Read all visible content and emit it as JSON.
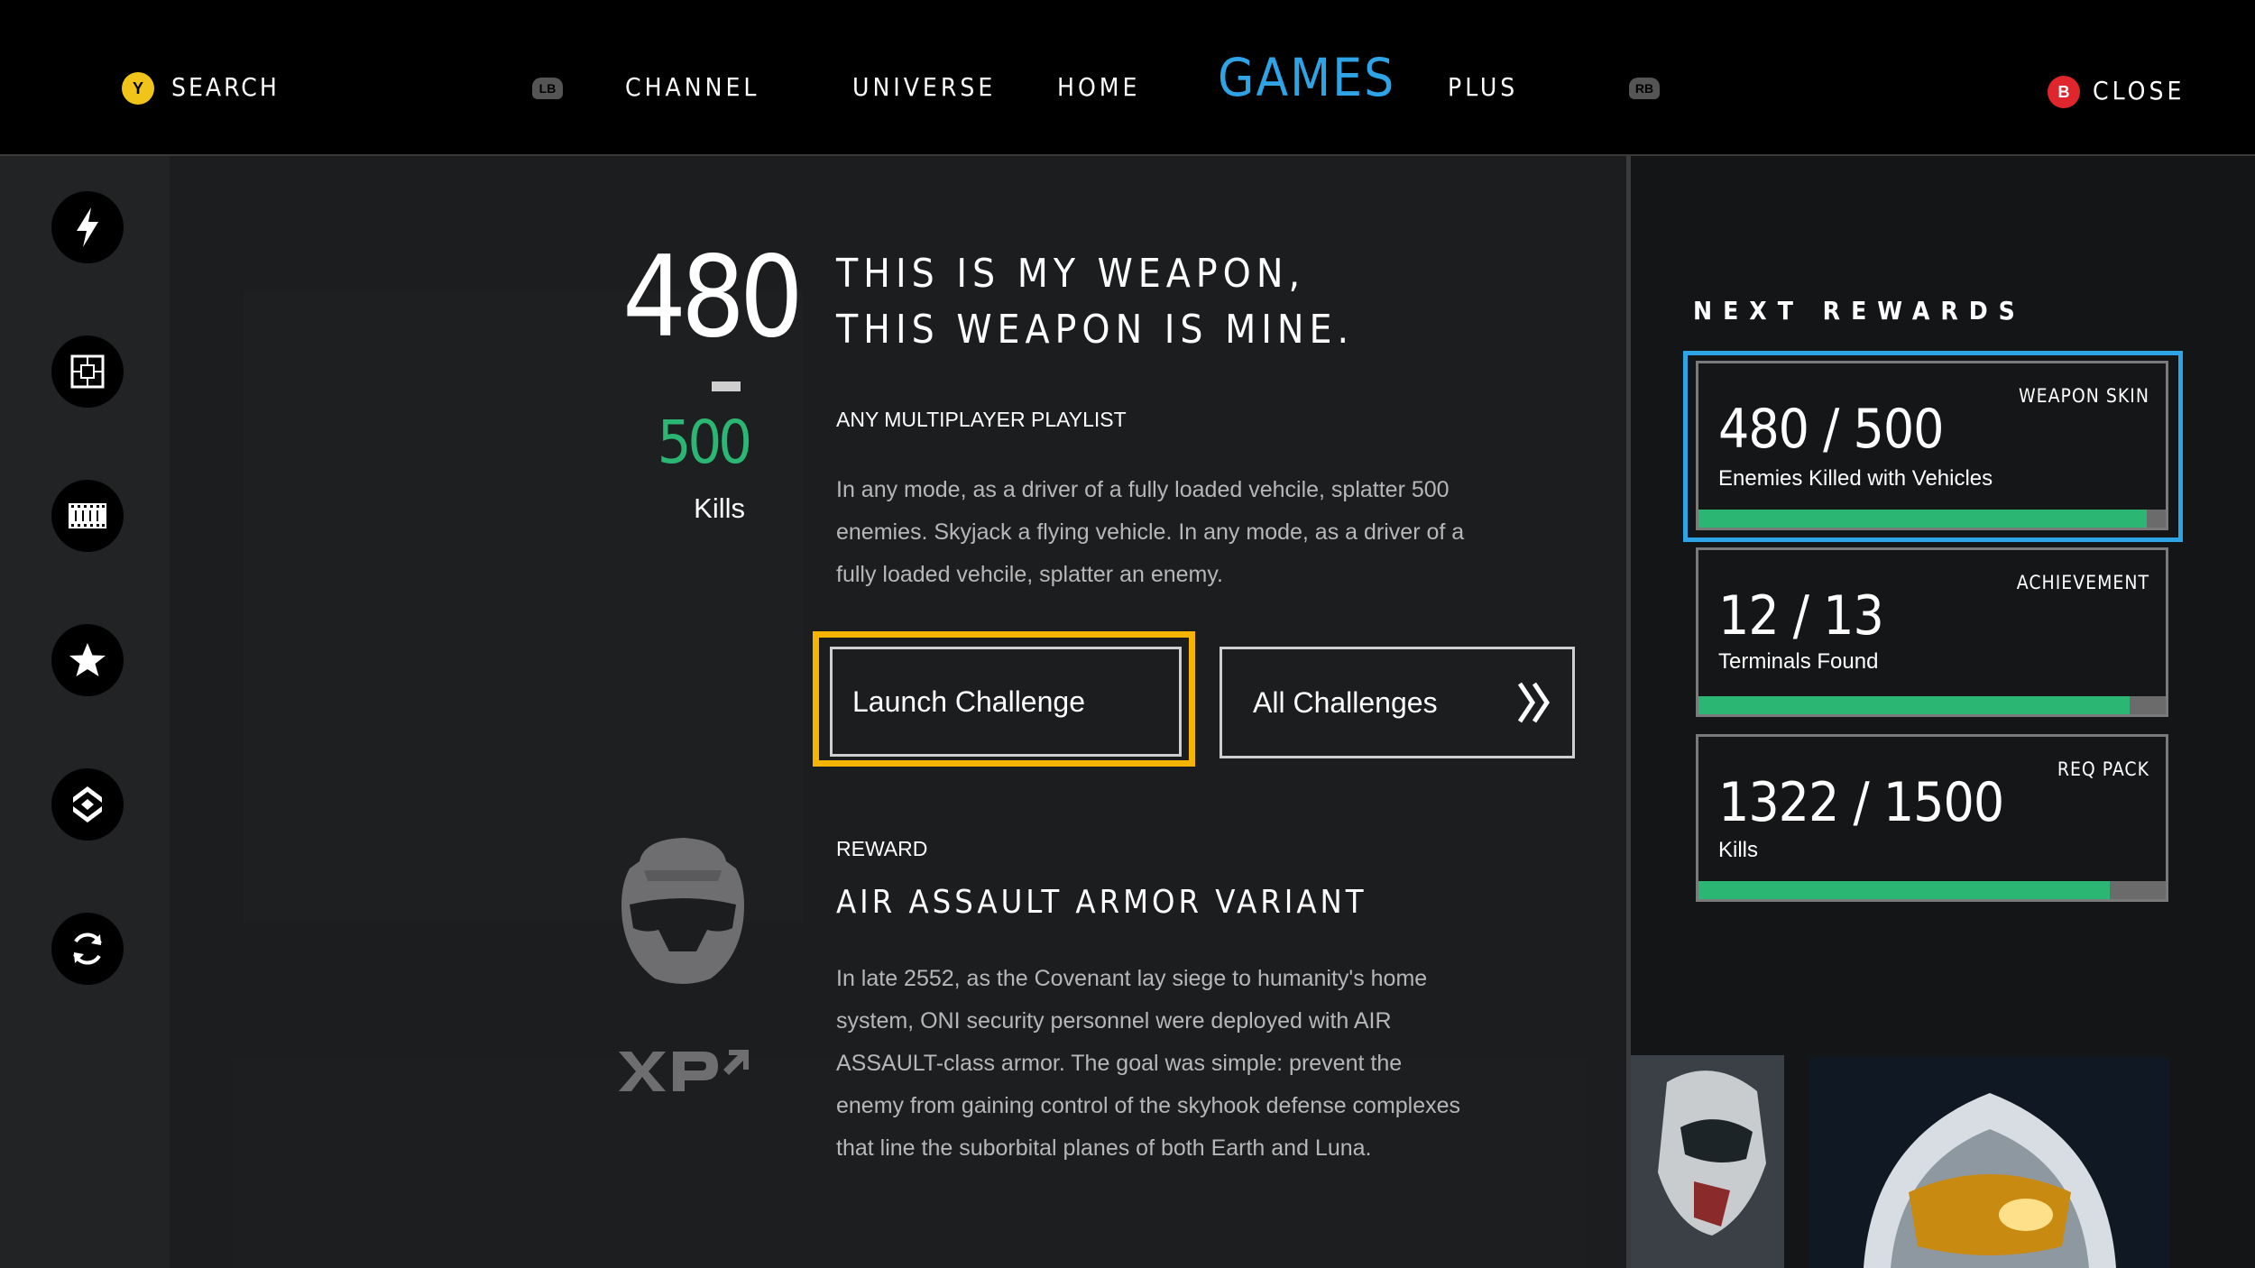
{
  "nav": {
    "search_button": "Y",
    "search_label": "SEARCH",
    "left_bumper": "LB",
    "right_bumper": "RB",
    "tabs": [
      "CHANNEL",
      "UNIVERSE",
      "HOME",
      "GAMES",
      "PLUS"
    ],
    "active_tab": "GAMES",
    "close_button": "B",
    "close_label": "CLOSE"
  },
  "sidebar": {
    "icons": [
      "lightning-icon",
      "crosshair-grid-icon",
      "film-icon",
      "star-icon",
      "chevrons-icon",
      "refresh-icon"
    ]
  },
  "challenge": {
    "current": "480",
    "target": "500",
    "unit": "Kills",
    "title_line1": "THIS IS MY WEAPON,",
    "title_line2": "THIS WEAPON IS MINE.",
    "playlist": "ANY MULTIPLAYER PLAYLIST",
    "description_lines": [
      "In any mode, as a driver of a fully loaded vehcile, splatter 500",
      "enemies.  Skyjack a flying vehicle. In any mode, as a driver of a",
      "fully loaded vehcile, splatter an enemy."
    ],
    "launch_button": "Launch Challenge",
    "all_button": "All Challenges"
  },
  "reward": {
    "heading": "REWARD",
    "name": "AIR ASSAULT ARMOR VARIANT",
    "xp_label": "XP",
    "description_lines": [
      "In late 2552, as the Covenant lay siege to humanity's home",
      "system, ONI security personnel were deployed with AIR",
      "ASSAULT-class armor. The goal was simple: prevent the",
      "enemy from gaining control of the skyhook defense complexes",
      "that line the suborbital planes of both Earth and Luna."
    ]
  },
  "next_rewards": {
    "heading": "NEXT REWARDS",
    "cards": [
      {
        "type": "WEAPON SKIN",
        "count": "480 / 500",
        "label": "Enemies Killed with Vehicles",
        "progress": 0.96,
        "selected": true
      },
      {
        "type": "ACHIEVEMENT",
        "count": "12 / 13",
        "label": "Terminals Found",
        "progress": 0.923,
        "selected": false
      },
      {
        "type": "REQ PACK",
        "count": "1322 / 1500",
        "label": "Kills",
        "progress": 0.88,
        "selected": false
      }
    ]
  },
  "colors": {
    "accent_blue": "#2ea3e6",
    "focus_yellow": "#f5b400",
    "progress_green": "#2bb673",
    "target_green": "#2bb673",
    "y_button": "#f0c419",
    "b_button": "#e0262d"
  }
}
